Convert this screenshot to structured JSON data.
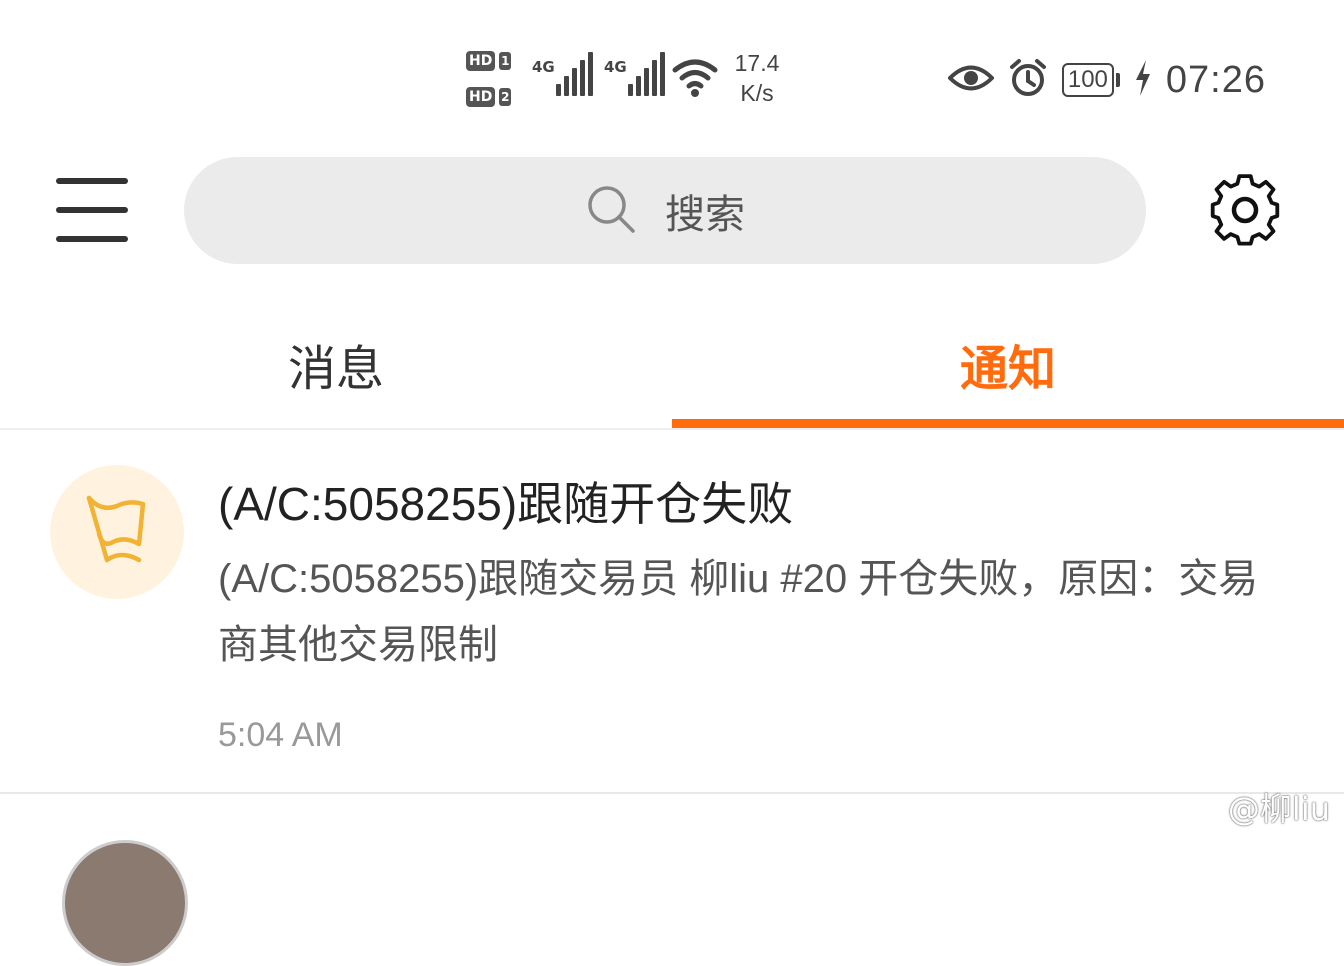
{
  "status_bar": {
    "sim1_label": "HD",
    "sim1_num": "1",
    "sim2_label": "HD",
    "sim2_num": "2",
    "net1": "4G",
    "net2": "4G",
    "speed_value": "17.4",
    "speed_unit": "K/s",
    "battery": "100",
    "time": "07:26"
  },
  "search": {
    "placeholder": "搜索"
  },
  "tabs": [
    {
      "label": "消息",
      "active": false
    },
    {
      "label": "通知",
      "active": true
    }
  ],
  "notifications": [
    {
      "title": "(A/C:5058255)跟随开仓失败",
      "body": "(A/C:5058255)跟随交易员 柳liu #20 开仓失败，原因：交易商其他交易限制",
      "time": "5:04 AM",
      "icon": "flag-icon"
    }
  ],
  "watermark": "@柳liu",
  "colors": {
    "accent": "#ff6b0d",
    "avatar_bg": "#fff3e0",
    "flag": "#f2b233"
  }
}
